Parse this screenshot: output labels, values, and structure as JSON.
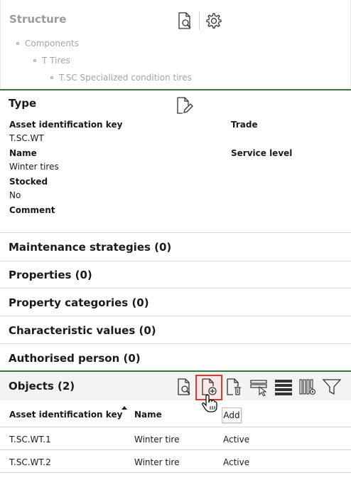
{
  "structure": {
    "title": "Structure",
    "tree": [
      {
        "label": "Components",
        "level": 0
      },
      {
        "label": "T Tires",
        "level": 1
      },
      {
        "label": "T.SC Specialized condition tires",
        "level": 2
      }
    ]
  },
  "type": {
    "title": "Type",
    "fields": {
      "asset_key_label": "Asset identification key",
      "asset_key_value": "T.SC.WT",
      "trade_label": "Trade",
      "name_label": "Name",
      "name_value": "Winter tires",
      "service_level_label": "Service level",
      "stocked_label": "Stocked",
      "stocked_value": "No",
      "comment_label": "Comment"
    }
  },
  "sections": [
    "Maintenance strategies (0)",
    "Properties (0)",
    "Property categories (0)",
    "Characteristic values (0)",
    "Authorised person (0)"
  ],
  "objects": {
    "title": "Objects (2)",
    "columns": [
      "Asset identification key",
      "Name",
      ""
    ],
    "rows": [
      [
        "T.SC.WT.1",
        "Winter tire",
        "Active"
      ],
      [
        "T.SC.WT.2",
        "Winter tire",
        "Active"
      ]
    ],
    "tooltip": "Add"
  },
  "icons": {
    "search_doc": "document-search-icon",
    "settings": "gear-icon",
    "edit_doc": "document-edit-icon",
    "add_doc": "document-add-icon",
    "delete_doc": "document-delete-icon",
    "select_list": "list-select-icon",
    "table_view": "table-view-icon",
    "column_settings": "column-settings-icon",
    "filter": "filter-icon"
  },
  "colors": {
    "accent_green": "#2f7d3f",
    "highlight_red": "#e0392b",
    "muted_text": "#a6a6a6"
  }
}
